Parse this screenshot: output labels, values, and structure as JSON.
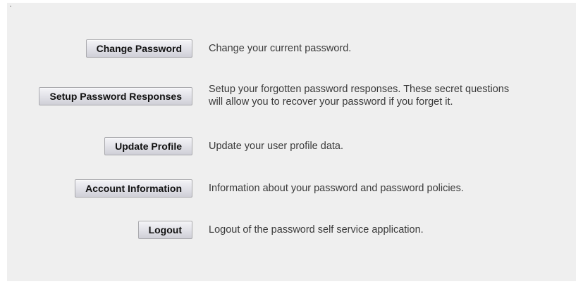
{
  "menu": [
    {
      "label": "Change Password",
      "description": "Change your current password."
    },
    {
      "label": "Setup Password Responses",
      "description_lines": [
        "Setup your forgotten password responses. These secret questions",
        "will allow you to recover your password if you forget it."
      ]
    },
    {
      "label": "Update Profile",
      "description": "Update your user profile data."
    },
    {
      "label": "Account Information",
      "description": "Information about your password and password policies."
    },
    {
      "label": "Logout",
      "description": "Logout of the password self service application."
    }
  ]
}
